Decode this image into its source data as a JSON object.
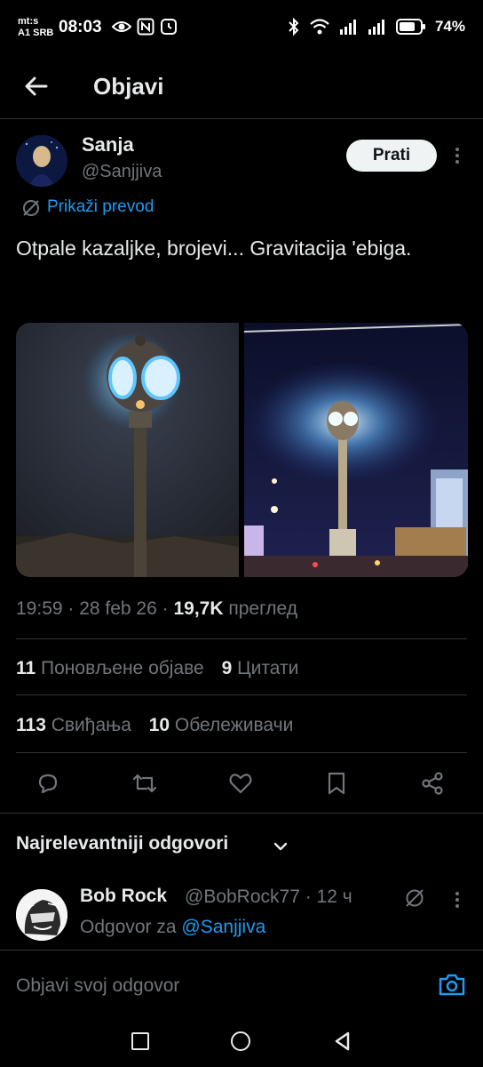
{
  "status_bar": {
    "carrier_line1": "mt:s",
    "carrier_line2": "A1 SRB",
    "time": "08:03",
    "battery": "74%"
  },
  "header": {
    "title": "Objavi"
  },
  "post": {
    "author_name": "Sanja",
    "author_handle": "@Sanjjiva",
    "follow_label": "Prati",
    "translate_label": "Prikaži prevod",
    "text": "Otpale kazaljke, brojevi... Gravitacija 'ebiga.",
    "time": "19:59 · 28 feb 26 · ",
    "views": "19,7K",
    "views_label": " преглед"
  },
  "stats": {
    "reposts": "11",
    "reposts_label": " Поновљене објаве",
    "quotes": "9",
    "quotes_label": " Цитати",
    "likes": "113",
    "likes_label": " Свиђања",
    "bookmarks": "10",
    "bookmarks_label": " Обележивачи"
  },
  "replies_section": {
    "sort_label": "Najrelevantniji odgovori"
  },
  "reply": {
    "author_name": "Bob Rock",
    "author_handle": "@BobRock77 · 12 ч",
    "reply_to_prefix": "Odgovor za ",
    "reply_to_handle": "@Sanjjiva"
  },
  "compose": {
    "placeholder": "Objavi svoj odgovor"
  },
  "colors": {
    "accent": "#1d9bf0",
    "background": "#000000",
    "muted": "#71767b"
  },
  "icons": [
    "back-arrow-icon",
    "more-icon",
    "translate-icon",
    "reply-icon",
    "repost-icon",
    "like-icon",
    "bookmark-icon",
    "share-icon",
    "chevron-down-icon",
    "camera-icon"
  ]
}
